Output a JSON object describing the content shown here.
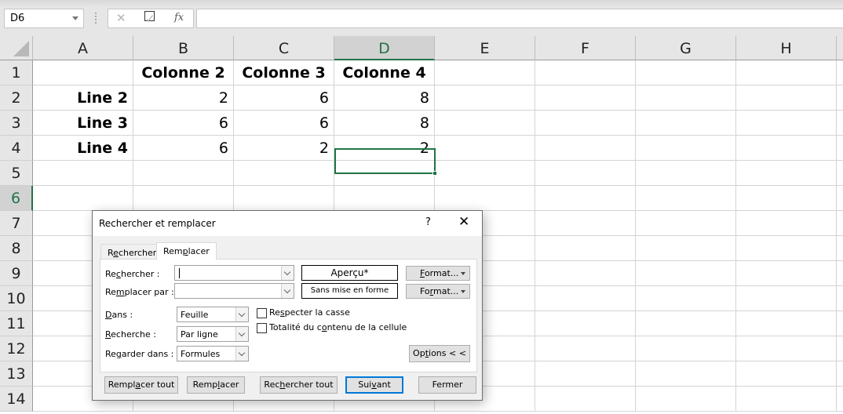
{
  "formula_bar": {
    "name_box": "D6",
    "cancel_icon": "✕",
    "enter_icon": "✓",
    "fx_label": "fx",
    "formula_value": ""
  },
  "sheet": {
    "columns": [
      "A",
      "B",
      "C",
      "D",
      "E",
      "F",
      "G",
      "H"
    ],
    "selected_column": "D",
    "rows": [
      "1",
      "2",
      "3",
      "4",
      "5",
      "6",
      "7",
      "8",
      "9",
      "10",
      "11",
      "12",
      "13",
      "14"
    ],
    "selected_row": "6",
    "active_cell": "D6",
    "cells": {
      "B1": "Colonne 2",
      "C1": "Colonne 3",
      "D1": "Colonne 4",
      "A2": "Line 2",
      "B2": "2",
      "C2": "6",
      "D2": "8",
      "A3": "Line 3",
      "B3": "6",
      "C3": "6",
      "D3": "8",
      "A4": "Line 4",
      "B4": "6",
      "C4": "2",
      "D4": "2"
    }
  },
  "dialog": {
    "title": "Rechercher et remplacer",
    "help": "?",
    "close": "✕",
    "tabs": [
      {
        "label_pre": "R",
        "label_u": "e",
        "label_post": "chercher",
        "active": false
      },
      {
        "label_pre": "Rem",
        "label_u": "p",
        "label_post": "lacer",
        "active": true
      }
    ],
    "find": {
      "label_pre": "Re",
      "label_u": "c",
      "label_post": "hercher :",
      "value": "",
      "preview": "Aperçu*"
    },
    "replace": {
      "label_pre": "Re",
      "label_u": "m",
      "label_post": "placer par :",
      "value": "",
      "preview": "Sans mise en forme"
    },
    "format1": {
      "pre": "",
      "u": "F",
      "post": "ormat..."
    },
    "format2": {
      "pre": "Fo",
      "u": "r",
      "post": "mat..."
    },
    "within": {
      "label_pre": "",
      "label_u": "D",
      "label_post": "ans :",
      "value": "Feuille"
    },
    "search": {
      "label_pre": "",
      "label_u": "R",
      "label_post": "echerche :",
      "value": "Par ligne"
    },
    "look_in": {
      "label_pre": "Re",
      "label_u": "g",
      "label_post": "arder dans :",
      "value": "Formules"
    },
    "match_case": {
      "pre": "Re",
      "u": "s",
      "post": "pecter la casse",
      "checked": false
    },
    "match_entire": {
      "pre": "Totalité du c",
      "u": "o",
      "post": "ntenu de la cellule",
      "checked": false
    },
    "options": {
      "pre": "Op",
      "u": "t",
      "post": "ions < <"
    },
    "buttons": {
      "replace_all": {
        "pre": "Rempl",
        "u": "a",
        "post": "cer tout"
      },
      "replace": {
        "pre": "Remp",
        "u": "l",
        "post": "acer"
      },
      "find_all": {
        "pre": "Rec",
        "u": "h",
        "post": "ercher tout"
      },
      "find_next": {
        "pre": "Sui",
        "u": "v",
        "post": "ant"
      },
      "close": {
        "pre": "Fermer",
        "u": "",
        "post": ""
      }
    }
  },
  "colors": {
    "excel_green": "#217346",
    "focus_blue": "#0078d7"
  }
}
